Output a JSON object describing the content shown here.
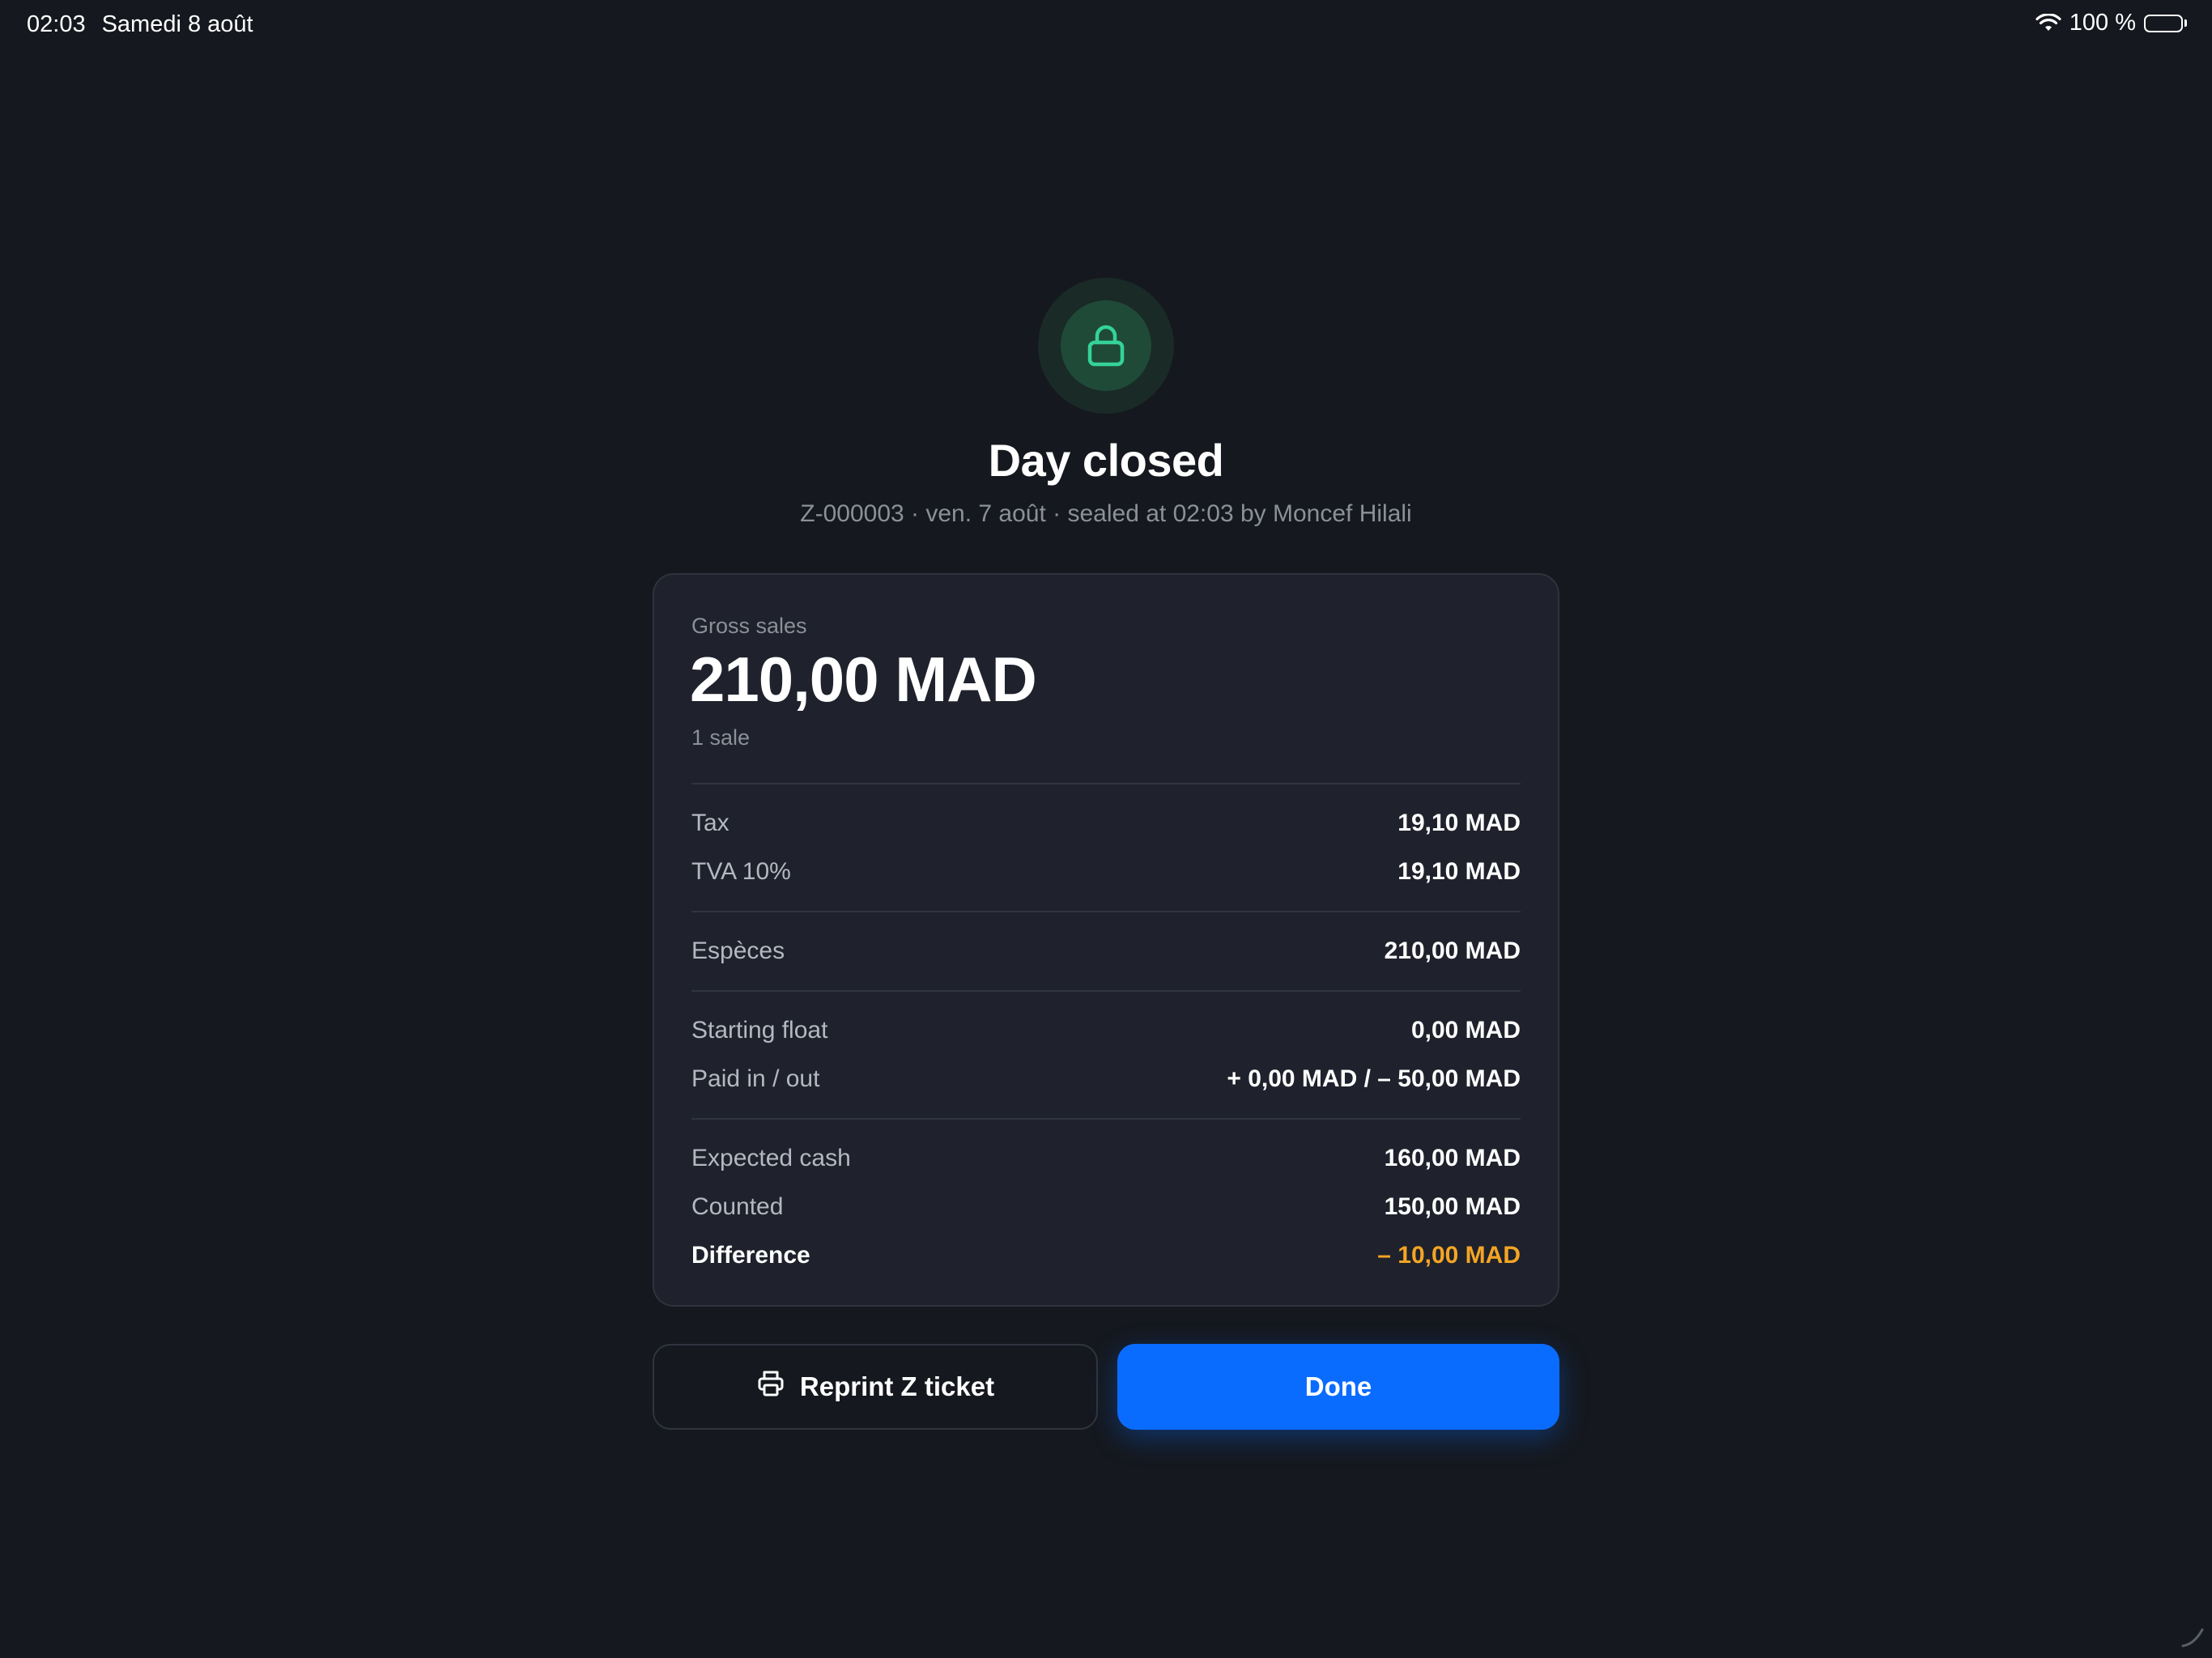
{
  "status_bar": {
    "time": "02:03",
    "date": "Samedi 8 août",
    "battery": "100 %"
  },
  "header": {
    "icon": "lock-icon",
    "title": "Day closed",
    "subtitle": "Z-000003 · ven. 7 août · sealed at 02:03 by Moncef Hilali"
  },
  "summary": {
    "gross_label": "Gross sales",
    "gross_value": "210,00 MAD",
    "sale_count": "1 sale",
    "tax": {
      "label": "Tax",
      "value": "19,10 MAD"
    },
    "tva": {
      "label": "TVA 10%",
      "value": "19,10 MAD"
    },
    "especes": {
      "label": "Espèces",
      "value": "210,00 MAD"
    },
    "starting_float": {
      "label": "Starting float",
      "value": "0,00 MAD"
    },
    "paid_in_out": {
      "label": "Paid in / out",
      "value": "+ 0,00 MAD / – 50,00 MAD"
    },
    "expected_cash": {
      "label": "Expected cash",
      "value": "160,00 MAD"
    },
    "counted": {
      "label": "Counted",
      "value": "150,00 MAD"
    },
    "difference": {
      "label": "Difference",
      "value": "– 10,00 MAD"
    }
  },
  "actions": {
    "reprint_label": "Reprint Z ticket",
    "reprint_icon": "printer-icon",
    "done_label": "Done"
  },
  "colors": {
    "background": "#15181e",
    "card": "#1f222c",
    "accent": "#0a6cff",
    "success": "#34d399",
    "warning": "#f5a524"
  }
}
